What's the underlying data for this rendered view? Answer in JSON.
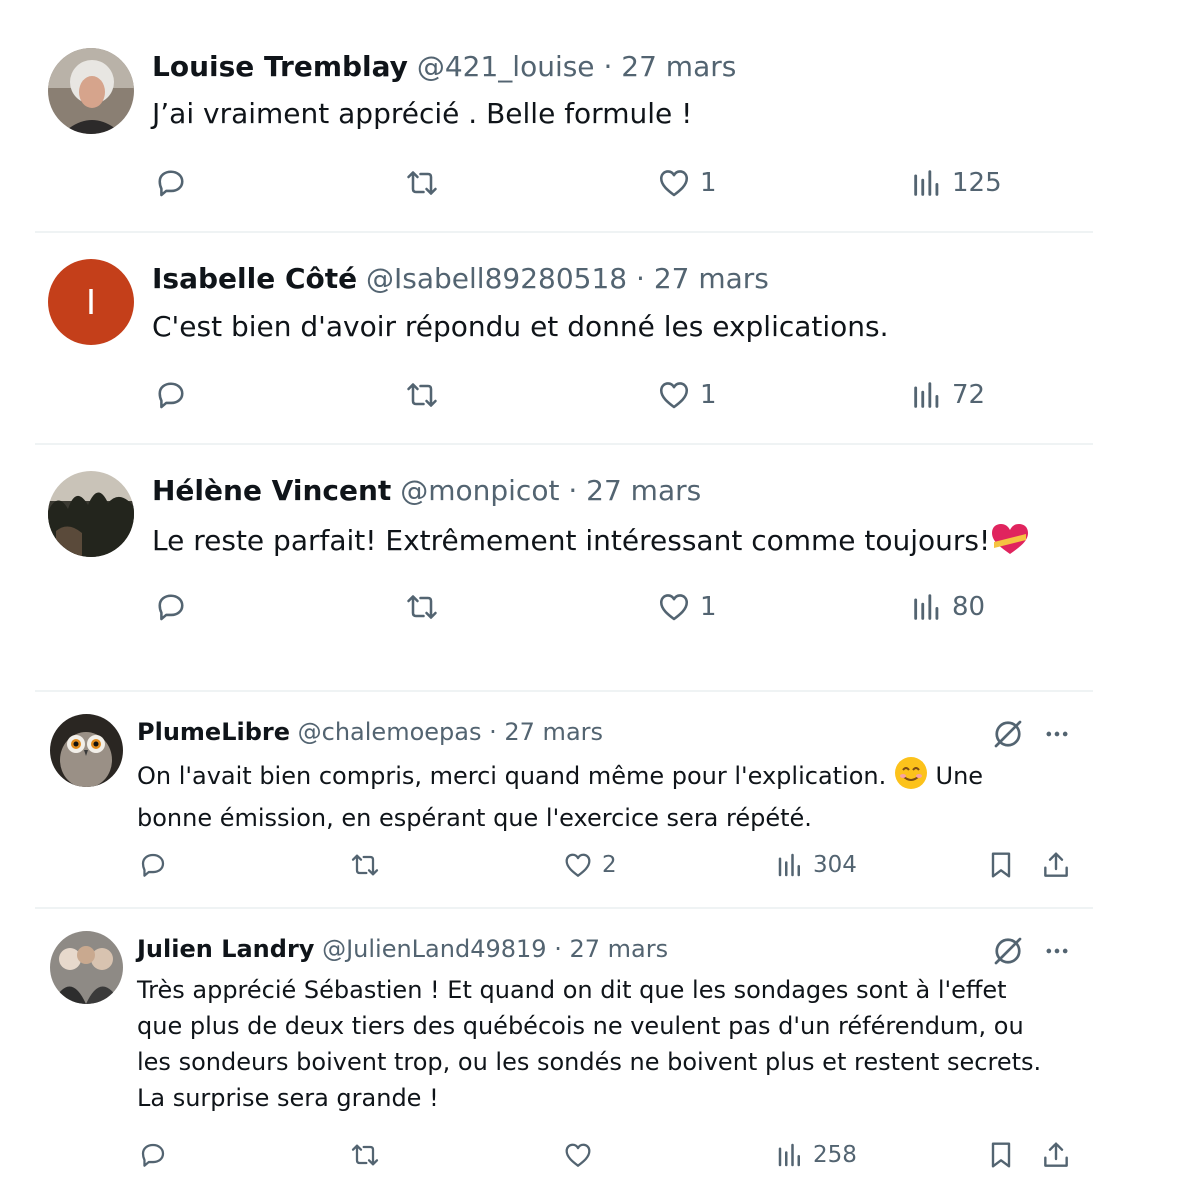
{
  "replies": [
    {
      "name": "Louise Tremblay",
      "handle": "@421_louise",
      "sep": "·",
      "date": "27 mars",
      "text": "J’ai vraiment apprécié . Belle formule !",
      "likes": "1",
      "views": "125"
    },
    {
      "name": "Isabelle Côté",
      "handle": "@Isabell89280518",
      "sep": "·",
      "date": "27 mars",
      "avatar_letter": "I",
      "avatar_color": "#c43f1a",
      "text": "C'est bien d'avoir répondu et donné les explications.",
      "likes": "1",
      "views": "72"
    },
    {
      "name": "Hélène Vincent",
      "handle": "@monpicot",
      "sep": "·",
      "date": "27 mars",
      "text": "Le reste parfait! Extrêmement intéressant comme toujours!",
      "likes": "1",
      "views": "80"
    },
    {
      "name": "PlumeLibre",
      "handle": "@chalemoepas",
      "sep": "·",
      "date": "27 mars",
      "text_line1_a": "On l'avait bien compris, merci quand même pour l'explication.",
      "text_line1_b": "Une",
      "text_line2": "bonne émission, en espérant que l'exercice sera répété.",
      "likes": "2",
      "views": "304"
    },
    {
      "name": "Julien Landry",
      "handle": "@JulienLand49819",
      "sep": "·",
      "date": "27 mars",
      "text_lines": [
        "Très apprécié Sébastien ! Et quand on dit que les sondages sont à l'effet",
        "que plus de deux tiers des québécois ne veulent pas d'un référendum, ou",
        "les sondeurs boivent trop, ou les sondés ne boivent plus et restent secrets.",
        "La surprise sera grande !"
      ],
      "likes": "",
      "views": "258"
    }
  ],
  "icons": {
    "reply": "reply-icon",
    "repost": "repost-icon",
    "like": "heart-icon",
    "views": "views-icon",
    "bookmark": "bookmark-icon",
    "share": "share-icon",
    "grok": "grok-icon",
    "more": "more-icon"
  },
  "colors": {
    "text": "#0f1419",
    "secondary": "#536471",
    "divider": "#eff3f4"
  }
}
